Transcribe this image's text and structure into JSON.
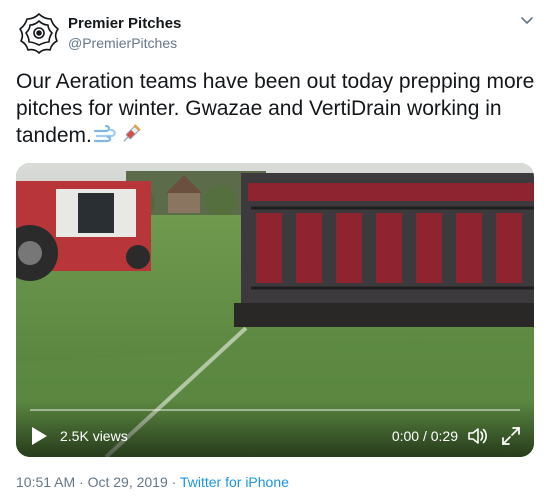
{
  "account": {
    "display_name": "Premier Pitches",
    "handle": "@PremierPitches",
    "avatar_icon": "tudor-rose-logo-icon"
  },
  "header": {
    "menu_icon": "chevron-down-icon"
  },
  "tweet": {
    "text": "Our Aeration teams have been out today prepping more pitches for winter. Gwazae and VertiDrain working in tandem.",
    "emojis": [
      "dashing-away-icon",
      "syringe-icon"
    ]
  },
  "video": {
    "views": "2.5K views",
    "time": "0:00 / 0:29",
    "progress": 0.0,
    "play_icon": "play-icon",
    "volume_icon": "volume-icon",
    "fullscreen_icon": "fullscreen-icon"
  },
  "meta": {
    "timestamp": "10:51 AM · Oct 29, 2019",
    "separator": "·",
    "source": "Twitter for iPhone"
  },
  "colors": {
    "text": "#14171a",
    "secondary": "#657786",
    "link": "#1b95e0"
  }
}
